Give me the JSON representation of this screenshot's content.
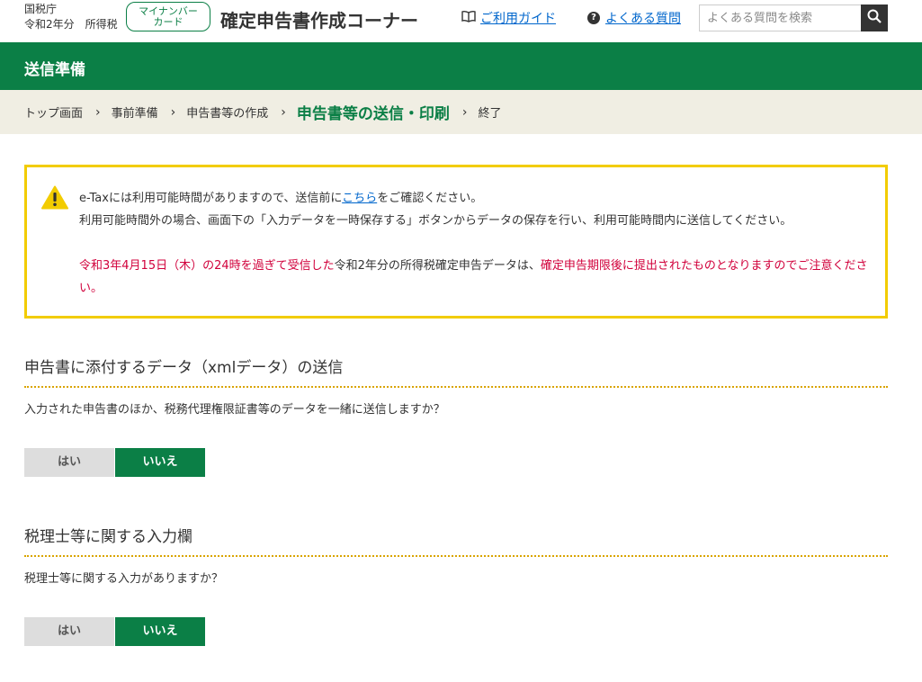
{
  "header": {
    "agency": "国税庁",
    "subtitle": "令和2年分　所得税",
    "mynumber_badge": [
      "マイナンバー",
      "カード"
    ],
    "site_title": "確定申告書作成コーナー",
    "guide_link": "ご利用ガイド",
    "faq_link": "よくある質問",
    "search_placeholder": "よくある質問を検索"
  },
  "section_title": "送信準備",
  "breadcrumb": [
    "トップ画面",
    "事前準備",
    "申告書等の作成",
    "申告書等の送信・印刷",
    "終了"
  ],
  "notice": {
    "line1_before": "e-Taxには利用可能時間がありますので、送信前に",
    "line1_link": "こちら",
    "line1_after": "をご確認ください。",
    "line2": "利用可能時間外の場合、画面下の「入力データを一時保存する」ボタンからデータの保存を行い、利用可能時間内に送信してください。",
    "line3_red1": "令和3年4月15日（木）の24時を過ぎて受信した",
    "line3_normal": "令和2年分の所得税確定申告データは、",
    "line3_red2": "確定申告期限後に提出されたものとなりますのでご注意ください。"
  },
  "sections": [
    {
      "heading": "申告書に添付するデータ（xmlデータ）の送信",
      "question": "入力された申告書のほか、税務代理権限証書等のデータを一緒に送信しますか？",
      "yes": "はい",
      "no": "いいえ",
      "selected": "いいえ"
    },
    {
      "heading": "税理士等に関する入力欄",
      "question": "税理士等に関する入力がありますか？",
      "yes": "はい",
      "no": "いいえ",
      "selected": "いいえ"
    }
  ],
  "colors": {
    "brand_green": "#0b7f46",
    "warning_yellow": "#f2cc00",
    "alert_red": "#d1003b",
    "breadcrumb_bg": "#f0eee3",
    "link_blue": "#0066cc"
  }
}
